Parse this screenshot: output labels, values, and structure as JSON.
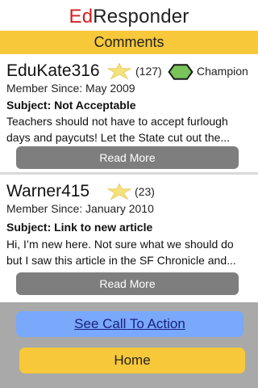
{
  "app": {
    "title_prefix": "Ed",
    "title_rest": "Responder"
  },
  "section": {
    "title": "Comments"
  },
  "comments": [
    {
      "username": "EduKate316",
      "rating_count": "(127)",
      "badge": "Champion",
      "member_since": "Member Since: May 2009",
      "subject": "Subject: Not Acceptable",
      "body": "Teachers should not have to accept furlough days and paycuts! Let the State cut out the...",
      "read_more_label": "Read More"
    },
    {
      "username": "Warner415",
      "rating_count": "(23)",
      "member_since": "Member Since: January 2010",
      "subject": "Subject: Link to new article",
      "body": "Hi, I’m new here. Not sure what we should do but I saw this article in the SF Chronicle and...",
      "read_more_label": "Read More"
    }
  ],
  "footer": {
    "cta_label": "See Call To Action",
    "home_label": "Home"
  },
  "icons": {
    "rating": "star-icon",
    "badge": "hexagon-badge-icon"
  },
  "colors": {
    "accent_yellow": "#f7c83a",
    "title_red": "#d32020",
    "cta_blue": "#7aa8fb",
    "badge_green": "#78c45a",
    "button_gray": "#7e7e7e"
  }
}
